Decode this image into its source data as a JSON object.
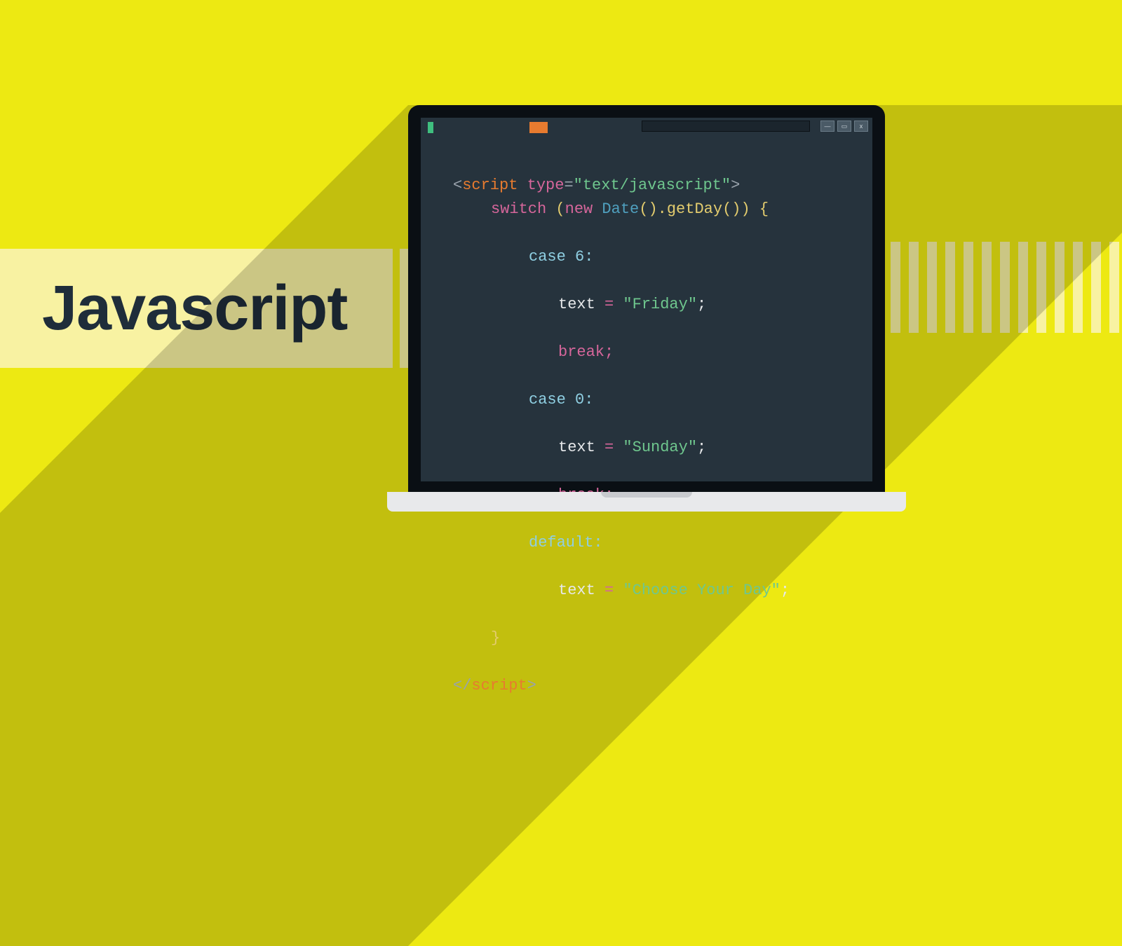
{
  "title": "Javascript",
  "window": {
    "min": "—",
    "max": "▭",
    "close": "x"
  },
  "code": {
    "l1_open": "<",
    "l1_tag": "script",
    "l1_sp": " ",
    "l1_attr": "type",
    "l1_eq": "=",
    "l1_val": "\"text/javascript\"",
    "l1_close": ">",
    "l2_kw": "switch",
    "l2_paren": " (",
    "l2_new": "new",
    "l2_date": " Date",
    "l2_call": "().getDay()) {",
    "l3": "case 6:",
    "l4_a": "text ",
    "l4_b": "= ",
    "l4_c": "\"Friday\"",
    "l4_d": ";",
    "l5": "break;",
    "l6": "case 0:",
    "l7_a": "text ",
    "l7_b": "= ",
    "l7_c": "\"Sunday\"",
    "l7_d": ";",
    "l8": "break;",
    "l9": "default:",
    "l10_a": "text ",
    "l10_b": "= ",
    "l10_c": "\"Choose Your Day\"",
    "l10_d": ";",
    "l11": "}",
    "l12_open": "</",
    "l12_tag": "script",
    "l12_close": ">"
  }
}
